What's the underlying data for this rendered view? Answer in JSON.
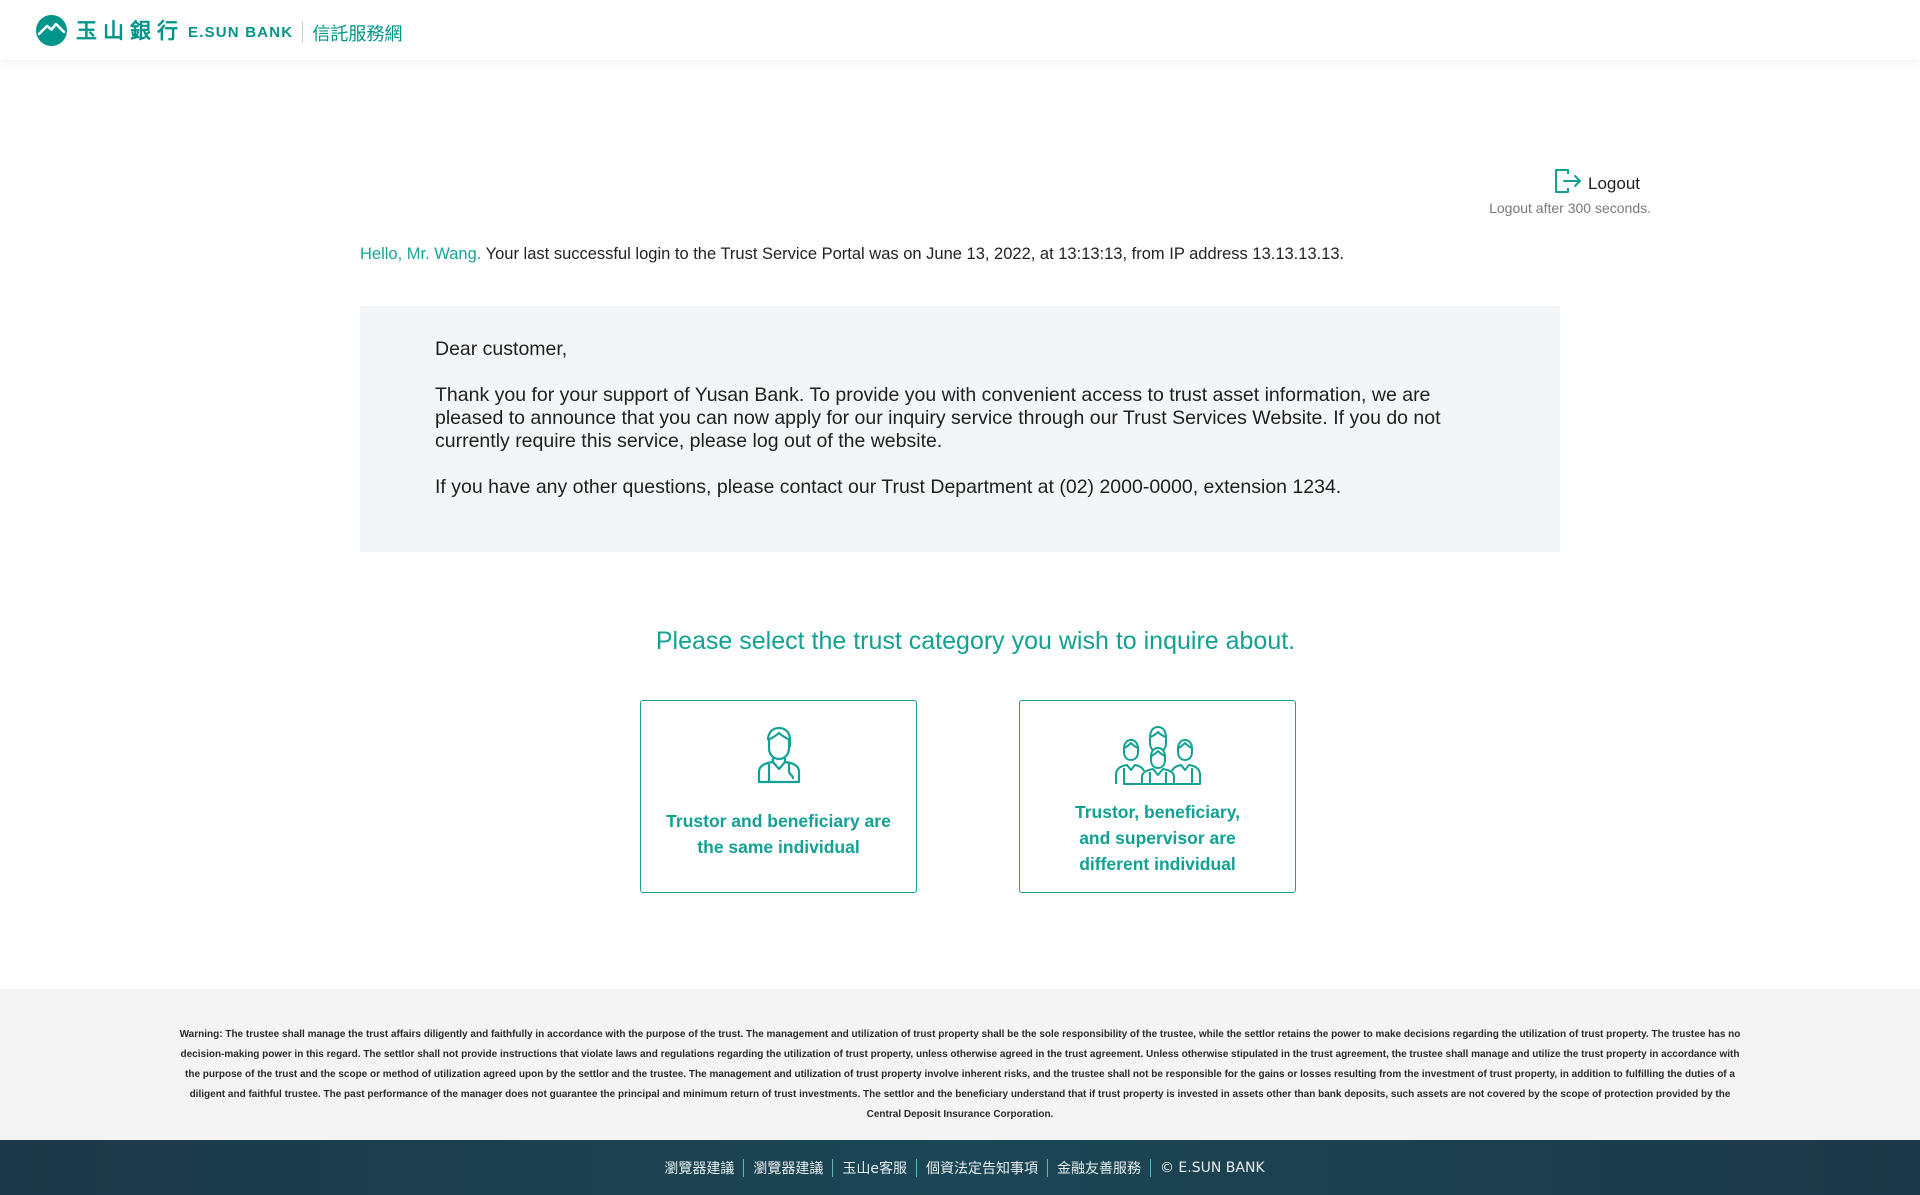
{
  "header": {
    "logo_chinese": "玉山銀行",
    "logo_english": "E.SUN BANK",
    "portal_name": "信託服務網"
  },
  "logout": {
    "label": "Logout",
    "countdown_note": "Logout after 300 seconds."
  },
  "greeting": {
    "hello": "Hello, Mr. Wang.",
    "last_login": " Your last successful login to the Trust Service Portal was on June 13, 2022, at 13:13:13, from IP address 13.13.13.13."
  },
  "notice": {
    "salutation": "Dear customer,",
    "body": "Thank you for your support of Yusan Bank. To provide you with convenient access to trust asset information, we are pleased to announce that you can now apply for our inquiry service through our Trust Services Website. If you do not currently require this service, please log out of the website.",
    "contact": "If you have any other questions, please contact our Trust Department at (02) 2000-0000, extension 1234."
  },
  "selection": {
    "title": "Please select the trust category you wish to inquire about.",
    "options": [
      {
        "line1": "Trustor and beneficiary are",
        "line2": "the same individual",
        "icon": "single-person-icon"
      },
      {
        "line1": "Trustor, beneficiary,",
        "line2": "and supervisor are",
        "line3": "different individual",
        "icon": "group-people-icon"
      }
    ]
  },
  "warning": {
    "text": "Warning: The trustee shall manage the trust affairs diligently and faithfully in accordance with the purpose of the trust. The management and utilization of trust property shall be the sole responsibility of the trustee, while the settlor retains the power to make decisions regarding the utilization of trust property. The trustee has no decision-making power in this regard. The settlor shall not provide instructions that violate laws and regulations regarding the utilization of trust property, unless otherwise agreed in the trust agreement. Unless otherwise stipulated in the trust agreement, the trustee shall manage and utilize the trust property in accordance with the purpose of the trust and the scope or method of utilization agreed upon by the settlor and the trustee. The management and utilization of trust property involve inherent risks, and the trustee shall not be responsible for the gains or losses resulting from the investment of trust property, in addition to fulfilling the duties of a diligent and faithful trustee. The past performance of the manager does not guarantee the principal and minimum return of trust investments. The settlor and the beneficiary understand that if trust property is invested in assets other than bank deposits, such assets are not covered by the scope of protection provided by the Central Deposit Insurance Corporation."
  },
  "footer": {
    "links": [
      "瀏覽器建議",
      "瀏覽器建議",
      "玉山e客服",
      "個資法定告知事項",
      "金融友善服務"
    ],
    "copyright": "© E.SUN BANK"
  },
  "colors": {
    "brand_teal": "#00958a",
    "accent_teal": "#12a193",
    "notice_bg": "#f3f6f8",
    "footer_bg": "#1d3848"
  }
}
